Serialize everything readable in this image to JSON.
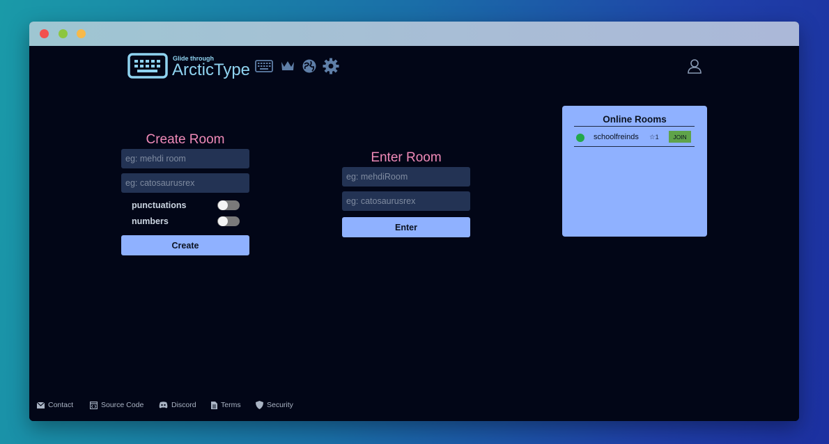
{
  "header": {
    "tagline": "Glide through",
    "brand": "ArcticType",
    "icons": [
      "keyboard-icon",
      "crown-icon",
      "globe-icon",
      "gear-icon",
      "user-icon"
    ]
  },
  "create_room": {
    "title": "Create Room",
    "room_placeholder": "eg: mehdi room",
    "user_placeholder": "eg: catosaurusrex",
    "toggles": [
      {
        "label": "punctuations",
        "on": false
      },
      {
        "label": "numbers",
        "on": false
      }
    ],
    "button_label": "Create"
  },
  "enter_room": {
    "title": "Enter Room",
    "room_placeholder": "eg: mehdiRoom",
    "user_placeholder": "eg: catosaurusrex",
    "button_label": "Enter"
  },
  "online_rooms": {
    "title": "Online Rooms",
    "rooms": [
      {
        "name": "schoolfreinds",
        "count": "☆1",
        "join_label": "JOIN"
      }
    ]
  },
  "footer": {
    "links": [
      "Contact",
      "Source Code",
      "Discord",
      "Terms",
      "Security"
    ]
  },
  "colors": {
    "background": "#020617",
    "accent_pink": "#f08ab8",
    "accent_blue": "#8fb1ff",
    "brand_cyan": "#8fd3f0",
    "online_green": "#22a84a"
  }
}
